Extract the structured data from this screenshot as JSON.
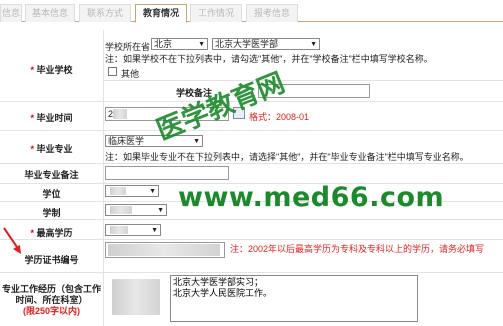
{
  "tabs": [
    {
      "label": "信息"
    },
    {
      "label": "基本信息"
    },
    {
      "label": "联系方式"
    },
    {
      "label": "教育情况"
    },
    {
      "label": "工作情况"
    },
    {
      "label": "报考信息"
    }
  ],
  "fields": {
    "school": {
      "label": "毕业学校",
      "location_prefix": "学校所在省",
      "province_value": "北京",
      "school_value": "北京大学医学部",
      "note": "注：如果学校不在下拉列表中，请勾选\"其他\"，并在\"学校备注\"栏中填写学校名称。",
      "other_label": "其他",
      "remark_label": "学校备注",
      "remark_value": ""
    },
    "grad_time": {
      "label": "毕业时间",
      "value": "2",
      "format_hint": "格式：2008-01"
    },
    "major": {
      "label": "毕业专业",
      "value": "临床医学",
      "note": "注：如果毕业专业不在下拉列表中，请选择\"其他\"，并在\"毕业专业备注\"栏中填写专业名称。"
    },
    "major_remark": {
      "label": "毕业专业备注",
      "value": ""
    },
    "degree": {
      "label": "学位"
    },
    "duration": {
      "label": "学制"
    },
    "highest_edu": {
      "label": "最高学历"
    },
    "cert_no": {
      "label": "学历证书编号",
      "note": "注：2002年以后最高学历为专科及专科以上的学历，请务必填写"
    },
    "work_history": {
      "label_line1": "专业工作经历（包含工作",
      "label_line2": "时间、所在科室）",
      "limit": "(限250字以内)",
      "value": "北京大学医学部实习；\n北京大学人民医院工作。"
    }
  },
  "watermark": {
    "chinese": "医学教育网",
    "url": "www.med66.com"
  },
  "colors": {
    "required": "#d00000",
    "hint_red": "#e02020",
    "watermark": "#1a8a2a"
  }
}
